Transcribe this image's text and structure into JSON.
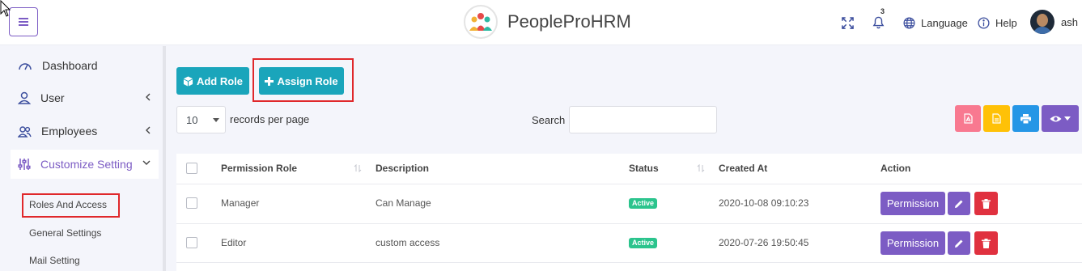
{
  "header": {
    "brand_name": "PeopleProHRM",
    "notification_count": "3",
    "language_label": "Language",
    "help_label": "Help",
    "user_name": "ash"
  },
  "sidebar": {
    "items": [
      {
        "label": "Dashboard",
        "icon": "gauge-icon"
      },
      {
        "label": "User",
        "icon": "user-icon"
      },
      {
        "label": "Employees",
        "icon": "users-icon"
      },
      {
        "label": "Customize Setting",
        "icon": "sliders-icon"
      }
    ],
    "sub_items": [
      "Roles And Access",
      "General Settings",
      "Mail Setting"
    ]
  },
  "toolbar": {
    "add_role_label": "Add Role",
    "assign_role_label": "Assign Role"
  },
  "table_controls": {
    "length_value": "10",
    "length_label": "records per page",
    "search_label": "Search",
    "search_value": ""
  },
  "export_buttons": [
    {
      "icon": "pdf-icon",
      "color": "#f87990"
    },
    {
      "icon": "csv-icon",
      "color": "#ffc107"
    },
    {
      "icon": "print-icon",
      "color": "#2596e6"
    },
    {
      "icon": "eye-icon",
      "color": "#7c5cc4"
    }
  ],
  "table": {
    "columns": [
      "Permission Role",
      "Description",
      "Status",
      "Created At",
      "Action"
    ],
    "rows": [
      {
        "role": "Manager",
        "description": "Can Manage",
        "status": "Active",
        "created_at": "2020-10-08 09:10:23",
        "action": "Permission"
      },
      {
        "role": "Editor",
        "description": "custom access",
        "status": "Active",
        "created_at": "2020-07-26 19:50:45",
        "action": "Permission"
      }
    ]
  },
  "colors": {
    "primary": "#7c5cc4",
    "teal": "#1aa5bb",
    "success": "#2bc48d",
    "danger": "#e0313f",
    "highlight": "#e0282b"
  }
}
